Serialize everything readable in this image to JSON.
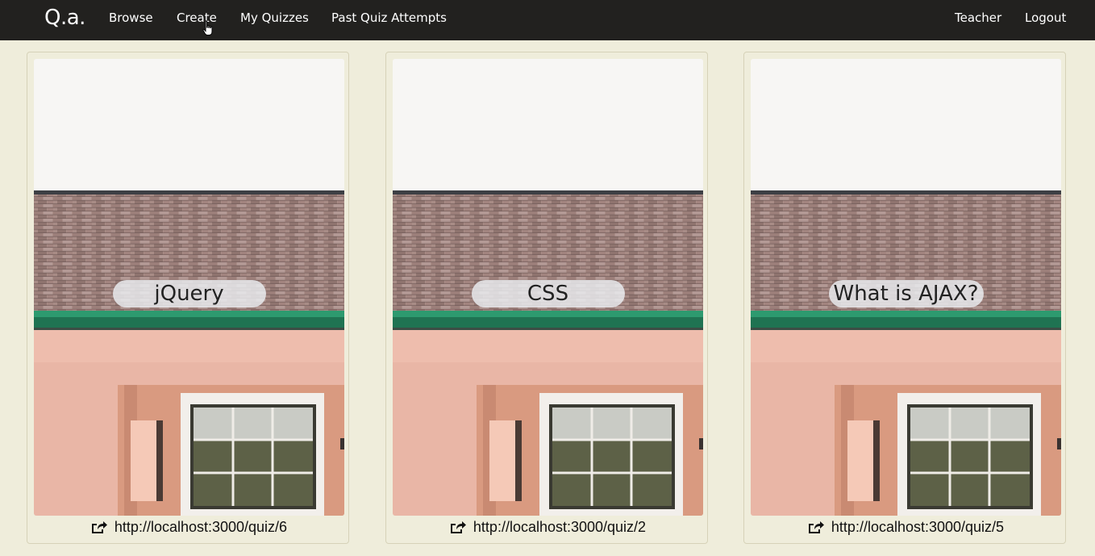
{
  "navbar": {
    "brand": "Q.a.",
    "links": [
      "Browse",
      "Create",
      "My Quizzes",
      "Past Quiz Attempts"
    ],
    "user_label": "Teacher",
    "logout_label": "Logout",
    "background_color": "#22211f"
  },
  "page": {
    "background_color": "#efeddb"
  },
  "quizzes": [
    {
      "title": "jQuery",
      "url": "http://localhost:3000/quiz/6"
    },
    {
      "title": "CSS",
      "url": "http://localhost:3000/quiz/2"
    },
    {
      "title": "What is AJAX?",
      "url": "http://localhost:3000/quiz/5"
    }
  ],
  "icons": {
    "share": "share-icon"
  }
}
